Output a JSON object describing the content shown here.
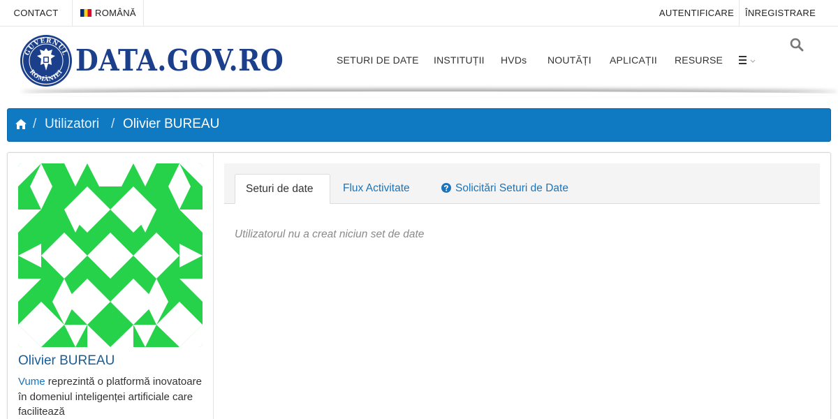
{
  "topbar": {
    "contact": "CONTACT",
    "language": "ROMÂNĂ",
    "login": "AUTENTIFICARE",
    "register": "ÎNREGISTRARE"
  },
  "header": {
    "logo_text": "DATA.GOV.RO",
    "seal_text": "GUVERNUL ROMÂNIEI",
    "nav": [
      "SETURI DE DATE",
      "INSTITUȚII",
      "HVDs",
      "NOUTĂȚI",
      "APLICAȚII",
      "RESURSE"
    ],
    "icons": {
      "menu": "hamburger-icon",
      "search": "search-icon"
    }
  },
  "breadcrumb": {
    "home_icon": "home-icon",
    "items": [
      "Utilizatori",
      "Olivier BUREAU"
    ]
  },
  "profile": {
    "name": "Olivier BUREAU",
    "desc_link": "Vume",
    "desc_rest": " reprezintă o platformă inovatoare în domeniul inteligenței artificiale care facilitează",
    "avatar_color": "#26d24a"
  },
  "tabs": {
    "items": [
      "Seturi de date",
      "Flux Activitate",
      "Solicitări Seturi de Date"
    ],
    "active": "Seturi de date",
    "empty_message": "Utilizatorul nu a creat niciun set de date"
  },
  "colors": {
    "accent": "#0f79c2",
    "link": "#1a74bb",
    "brand": "#1b3f8a"
  }
}
